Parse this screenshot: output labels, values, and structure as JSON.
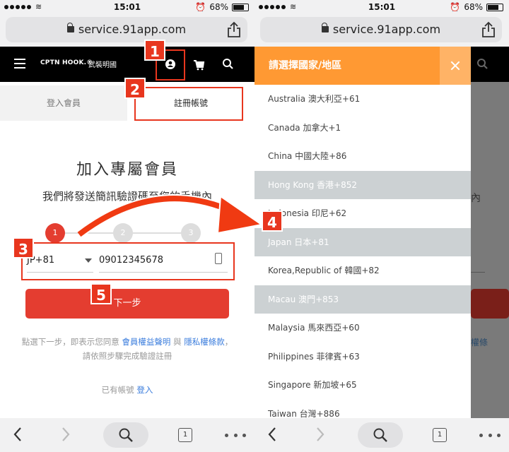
{
  "status": {
    "time": "15:01",
    "battery": "68%",
    "battery_level": 0.68
  },
  "browser": {
    "url": "service.91app.com",
    "tab_count": "1"
  },
  "site": {
    "logo": "CPTN HOOK.®",
    "logo_sub": "武裝明國"
  },
  "tabs": [
    {
      "label": "登入會員"
    },
    {
      "label": "註冊帳號"
    }
  ],
  "form": {
    "title": "加入專屬會員",
    "subtitle": "我們將發送簡訊驗證碼至您的手機內",
    "steps": [
      "1",
      "2",
      "3"
    ],
    "country_code": "JP+81",
    "phone": "09012345678",
    "next_label": "下一步",
    "terms_prefix": "點選下一步，即表示您同意",
    "terms_link1": "會員權益聲明",
    "terms_and": "與",
    "terms_link2": "隱私權條款",
    "terms_suffix": "，請依照步驟完成驗證註冊",
    "have_account": "已有帳號",
    "login_link": "登入"
  },
  "right_bg": {
    "text1": "內",
    "text2": "權條"
  },
  "modal": {
    "title": "請選擇國家/地區",
    "countries": [
      "Australia 澳大利亞+61",
      "Canada 加拿大+1",
      "China 中國大陸+86",
      "Hong Kong 香港+852",
      "Indonesia 印尼+62",
      "Japan 日本+81",
      "Korea,Republic of 韓國+82",
      "Macau 澳門+853",
      "Malaysia 馬來西亞+60",
      "Philippines 菲律賓+63",
      "Singapore 新加坡+65",
      "Taiwan 台灣+886"
    ]
  },
  "annotations": [
    "1",
    "2",
    "3",
    "4",
    "5"
  ],
  "colors": {
    "accent": "#e43d30",
    "modal_header": "#ff9933",
    "annotation": "#e8361e",
    "link": "#3b7ddd"
  }
}
